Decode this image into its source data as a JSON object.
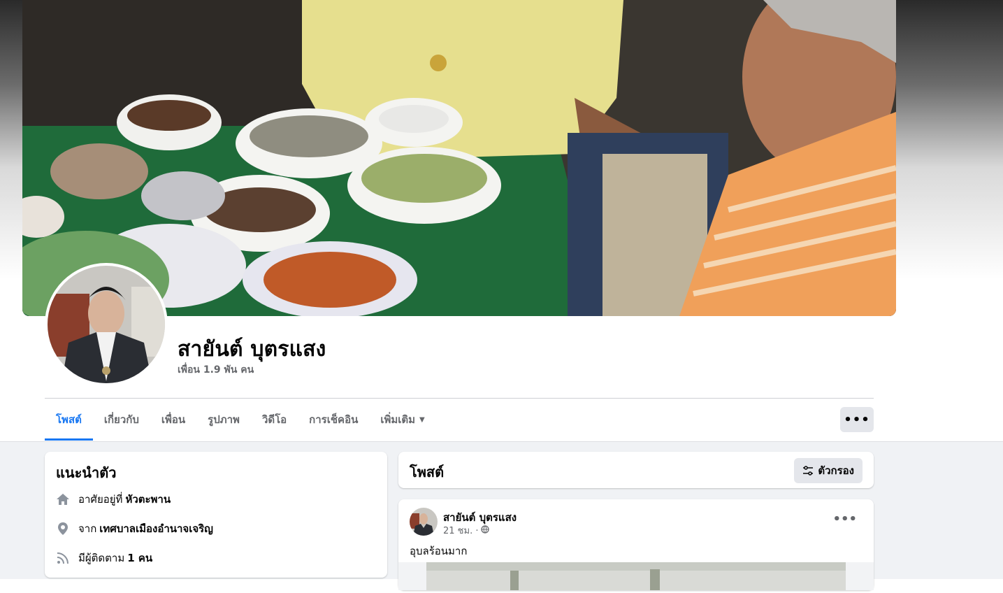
{
  "profile": {
    "name": "สายันต์ บุตรแสง",
    "friends": "เพื่อน 1.9 พัน คน"
  },
  "tabs": [
    {
      "label": "โพสต์",
      "active": true
    },
    {
      "label": "เกี่ยวกับ"
    },
    {
      "label": "เพื่อน"
    },
    {
      "label": "รูปภาพ"
    },
    {
      "label": "วิดีโอ"
    },
    {
      "label": "การเช็คอิน"
    },
    {
      "label": "เพิ่มเติม",
      "icon": "caret-down-icon"
    }
  ],
  "more_button": "•••",
  "intro": {
    "title": "แนะนำตัว",
    "rows": [
      {
        "icon": "home-icon",
        "prefix": "อาศัยอยู่ที่",
        "value": "หัวตะพาน"
      },
      {
        "icon": "location-pin-icon",
        "prefix": "จาก",
        "value": "เทศบาลเมืองอำนาจเจริญ"
      },
      {
        "icon": "rss-icon",
        "prefix": "มีผู้ติดตาม",
        "value": "1 คน"
      }
    ]
  },
  "posts": {
    "title": "โพสต์",
    "filter_label": "ตัวกรอง"
  },
  "post": {
    "author": "สายันต์ บุตรแสง",
    "time": "21 ชม. ·",
    "privacy_icon": "globe-icon",
    "text": "อุบลร้อนมาก",
    "more": "•••"
  },
  "colors": {
    "accent": "#1877f2",
    "secondary_text": "#65676b",
    "button_bg": "#e4e6eb",
    "feed_bg": "#f0f2f5"
  }
}
